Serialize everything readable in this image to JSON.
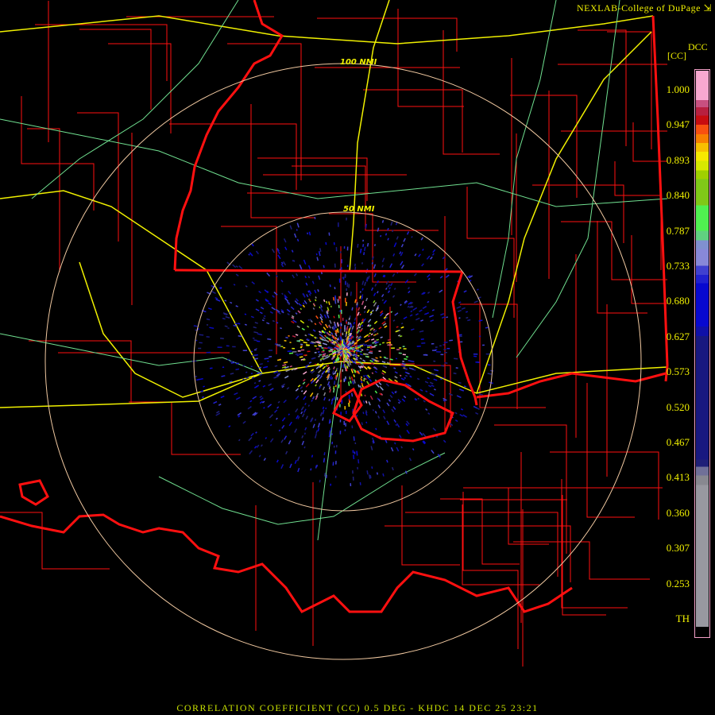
{
  "credit": "NEXLAB-College of DuPage",
  "credit_icon": "external-link-icon",
  "product_code": "DCC",
  "unit": "[CC]",
  "rings": [
    "100 NMI",
    "50 NMI"
  ],
  "legend": {
    "labels": [
      "1.000",
      "0.947",
      "0.893",
      "0.840",
      "0.787",
      "0.733",
      "0.680",
      "0.627",
      "0.573",
      "0.520",
      "0.467",
      "0.413",
      "0.360",
      "0.307",
      "0.253",
      "TH"
    ],
    "colors": [
      "#f8a8d0",
      "#c85080",
      "#b82040",
      "#c80c10",
      "#f85010",
      "#f88000",
      "#f8c000",
      "#f8e800",
      "#d8e800",
      "#a0d000",
      "#80c818",
      "#50f050",
      "#60d080",
      "#8090d0",
      "#8888d8",
      "#4040d0",
      "#2020d0",
      "#0808d0",
      "#1010a8",
      "#181880",
      "#202078",
      "#707098",
      "#888890",
      "#9898a0"
    ]
  },
  "footer": "CORRELATION COEFFICIENT (CC) 0.5 DEG - KHDC 14 DEC 25 23:21",
  "map_colors": {
    "boundary": "#ff1010",
    "highway": "#f0f000",
    "road": "#70e090",
    "ring": "#f0c8a0"
  }
}
